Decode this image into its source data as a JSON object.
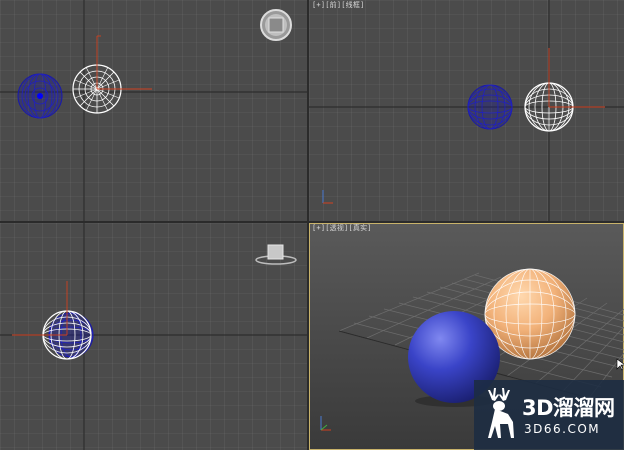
{
  "viewports": {
    "top": {
      "label": ""
    },
    "front": {
      "label": "[+][前][线框]"
    },
    "left": {
      "label": ""
    },
    "perspective": {
      "label": "[+][透视][真实]"
    }
  },
  "watermark": {
    "title": "3D溜溜网",
    "url": "3D66.COM"
  },
  "colors": {
    "viewport_bg": "#4b4b4b",
    "grid_line": "#6a6a6a",
    "grid_major": "#2e2e2e",
    "wire_white": "#ffffff",
    "wire_blue": "#1a1aa8",
    "sphere_orange": "#f2b27a",
    "sphere_blue": "#3a44c8",
    "active_border": "#c9b36a"
  }
}
